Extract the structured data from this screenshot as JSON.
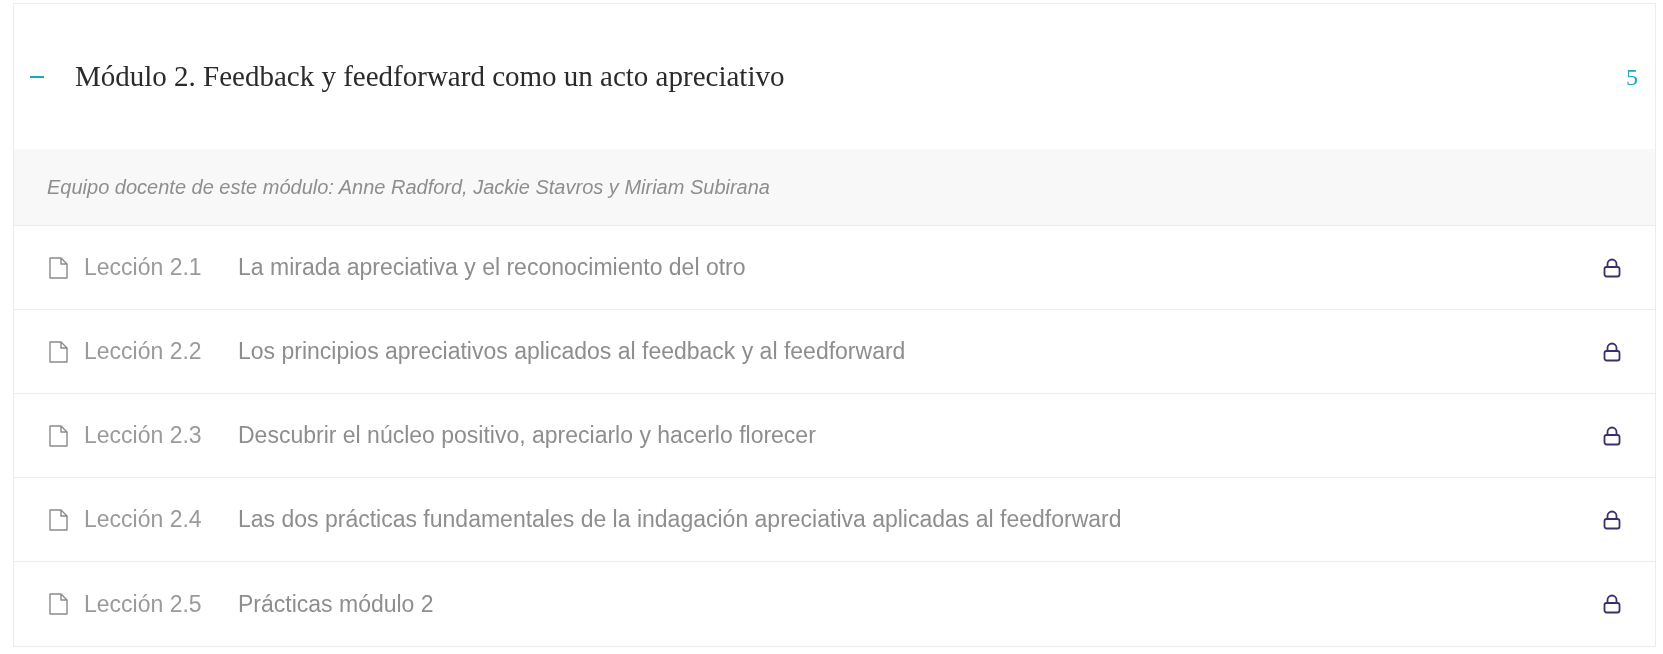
{
  "module": {
    "title": "Módulo 2. Feedback y feedforward como un acto apreciativo",
    "expanded": true,
    "count": "5",
    "description": "Equipo docente de este módulo: Anne Radford, Jackie Stavros y Miriam Subirana",
    "lessons": [
      {
        "number": "Lección 2.1",
        "title": "La mirada apreciativa y el reconocimiento del otro",
        "locked": true
      },
      {
        "number": "Lección 2.2",
        "title": "Los principios apreciativos aplicados al feedback y al feedforward",
        "locked": true
      },
      {
        "number": "Lección 2.3",
        "title": "Descubrir el núcleo positivo, apreciarlo y hacerlo florecer",
        "locked": true
      },
      {
        "number": "Lección 2.4",
        "title": "Las dos prácticas fundamentales de la indagación apreciativa aplicadas al feedforward",
        "locked": true
      },
      {
        "number": "Lección 2.5",
        "title": "Prácticas módulo 2",
        "locked": true
      }
    ]
  }
}
